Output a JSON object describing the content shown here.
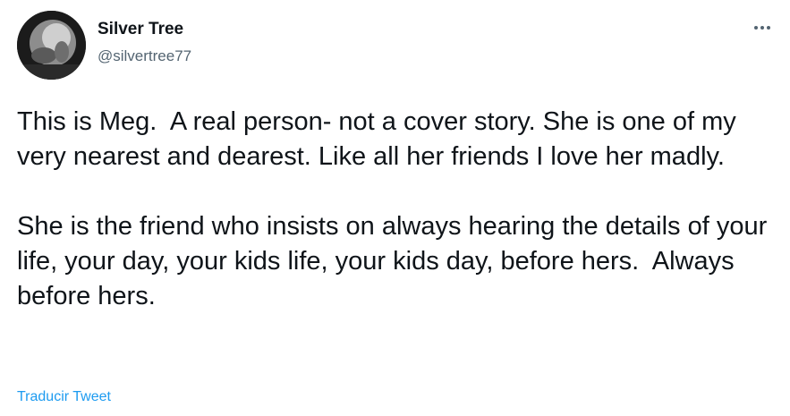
{
  "tweet": {
    "author": {
      "display_name": "Silver Tree",
      "handle": "@silvertree77"
    },
    "more_icon": "more-horizontal-icon",
    "paragraphs": [
      "This is Meg.  A real person- not a cover story. She is one of my very nearest and dearest. Like all her friends I love her madly.",
      "She is the friend who insists on always hearing the details of your life, your day, your kids life, your kids day, before hers.  Always before hers."
    ],
    "translate_label": "Traducir Tweet"
  },
  "colors": {
    "text_primary": "#0f1419",
    "text_secondary": "#536471",
    "link": "#1d9bf0",
    "background": "#ffffff"
  }
}
